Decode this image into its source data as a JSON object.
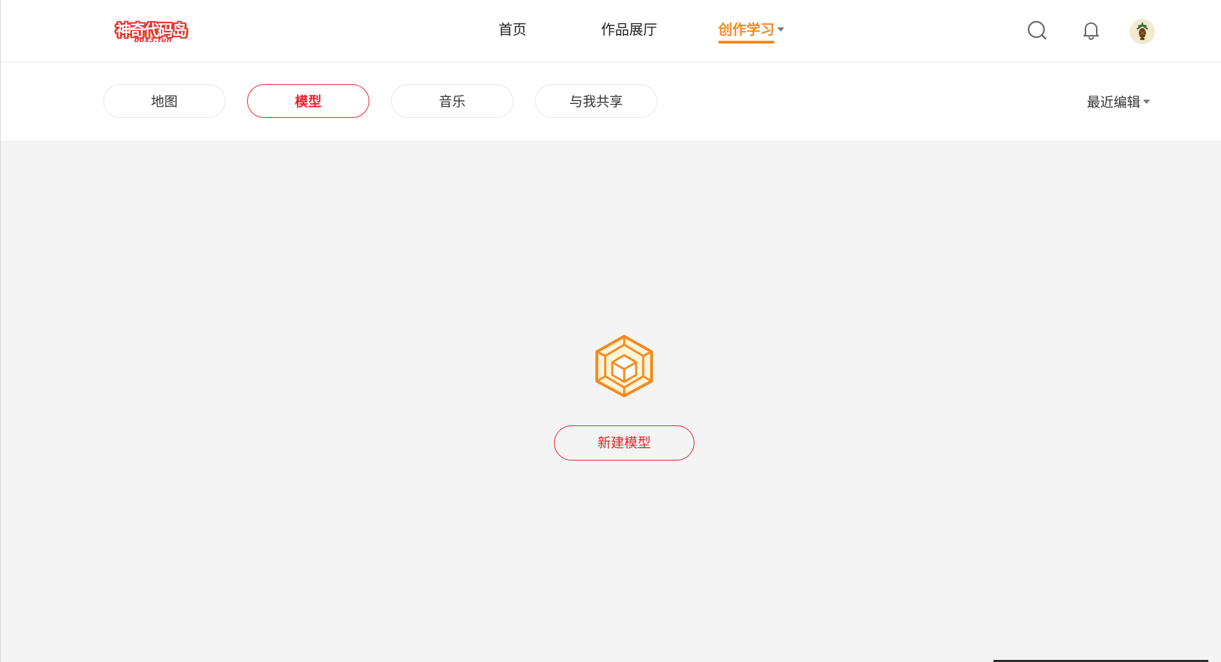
{
  "header": {
    "logo_text": "神奇代码岛",
    "logo_sub": "box3.fun",
    "nav": [
      {
        "label": "首页"
      },
      {
        "label": "作品展厅"
      },
      {
        "label": "创作学习"
      }
    ],
    "icons": [
      "search-icon",
      "bell-icon",
      "avatar"
    ]
  },
  "filters": {
    "tabs": [
      {
        "label": "地图"
      },
      {
        "label": "模型"
      },
      {
        "label": "音乐"
      },
      {
        "label": "与我共享"
      }
    ],
    "active_tab": "模型",
    "sort_label": "最近编辑"
  },
  "empty_state": {
    "icon": "cube-icon",
    "button_label": "新建模型"
  },
  "colors": {
    "accent_orange": "#f5891f",
    "accent_red": "#e8242c",
    "background": "#f4f4f4"
  }
}
